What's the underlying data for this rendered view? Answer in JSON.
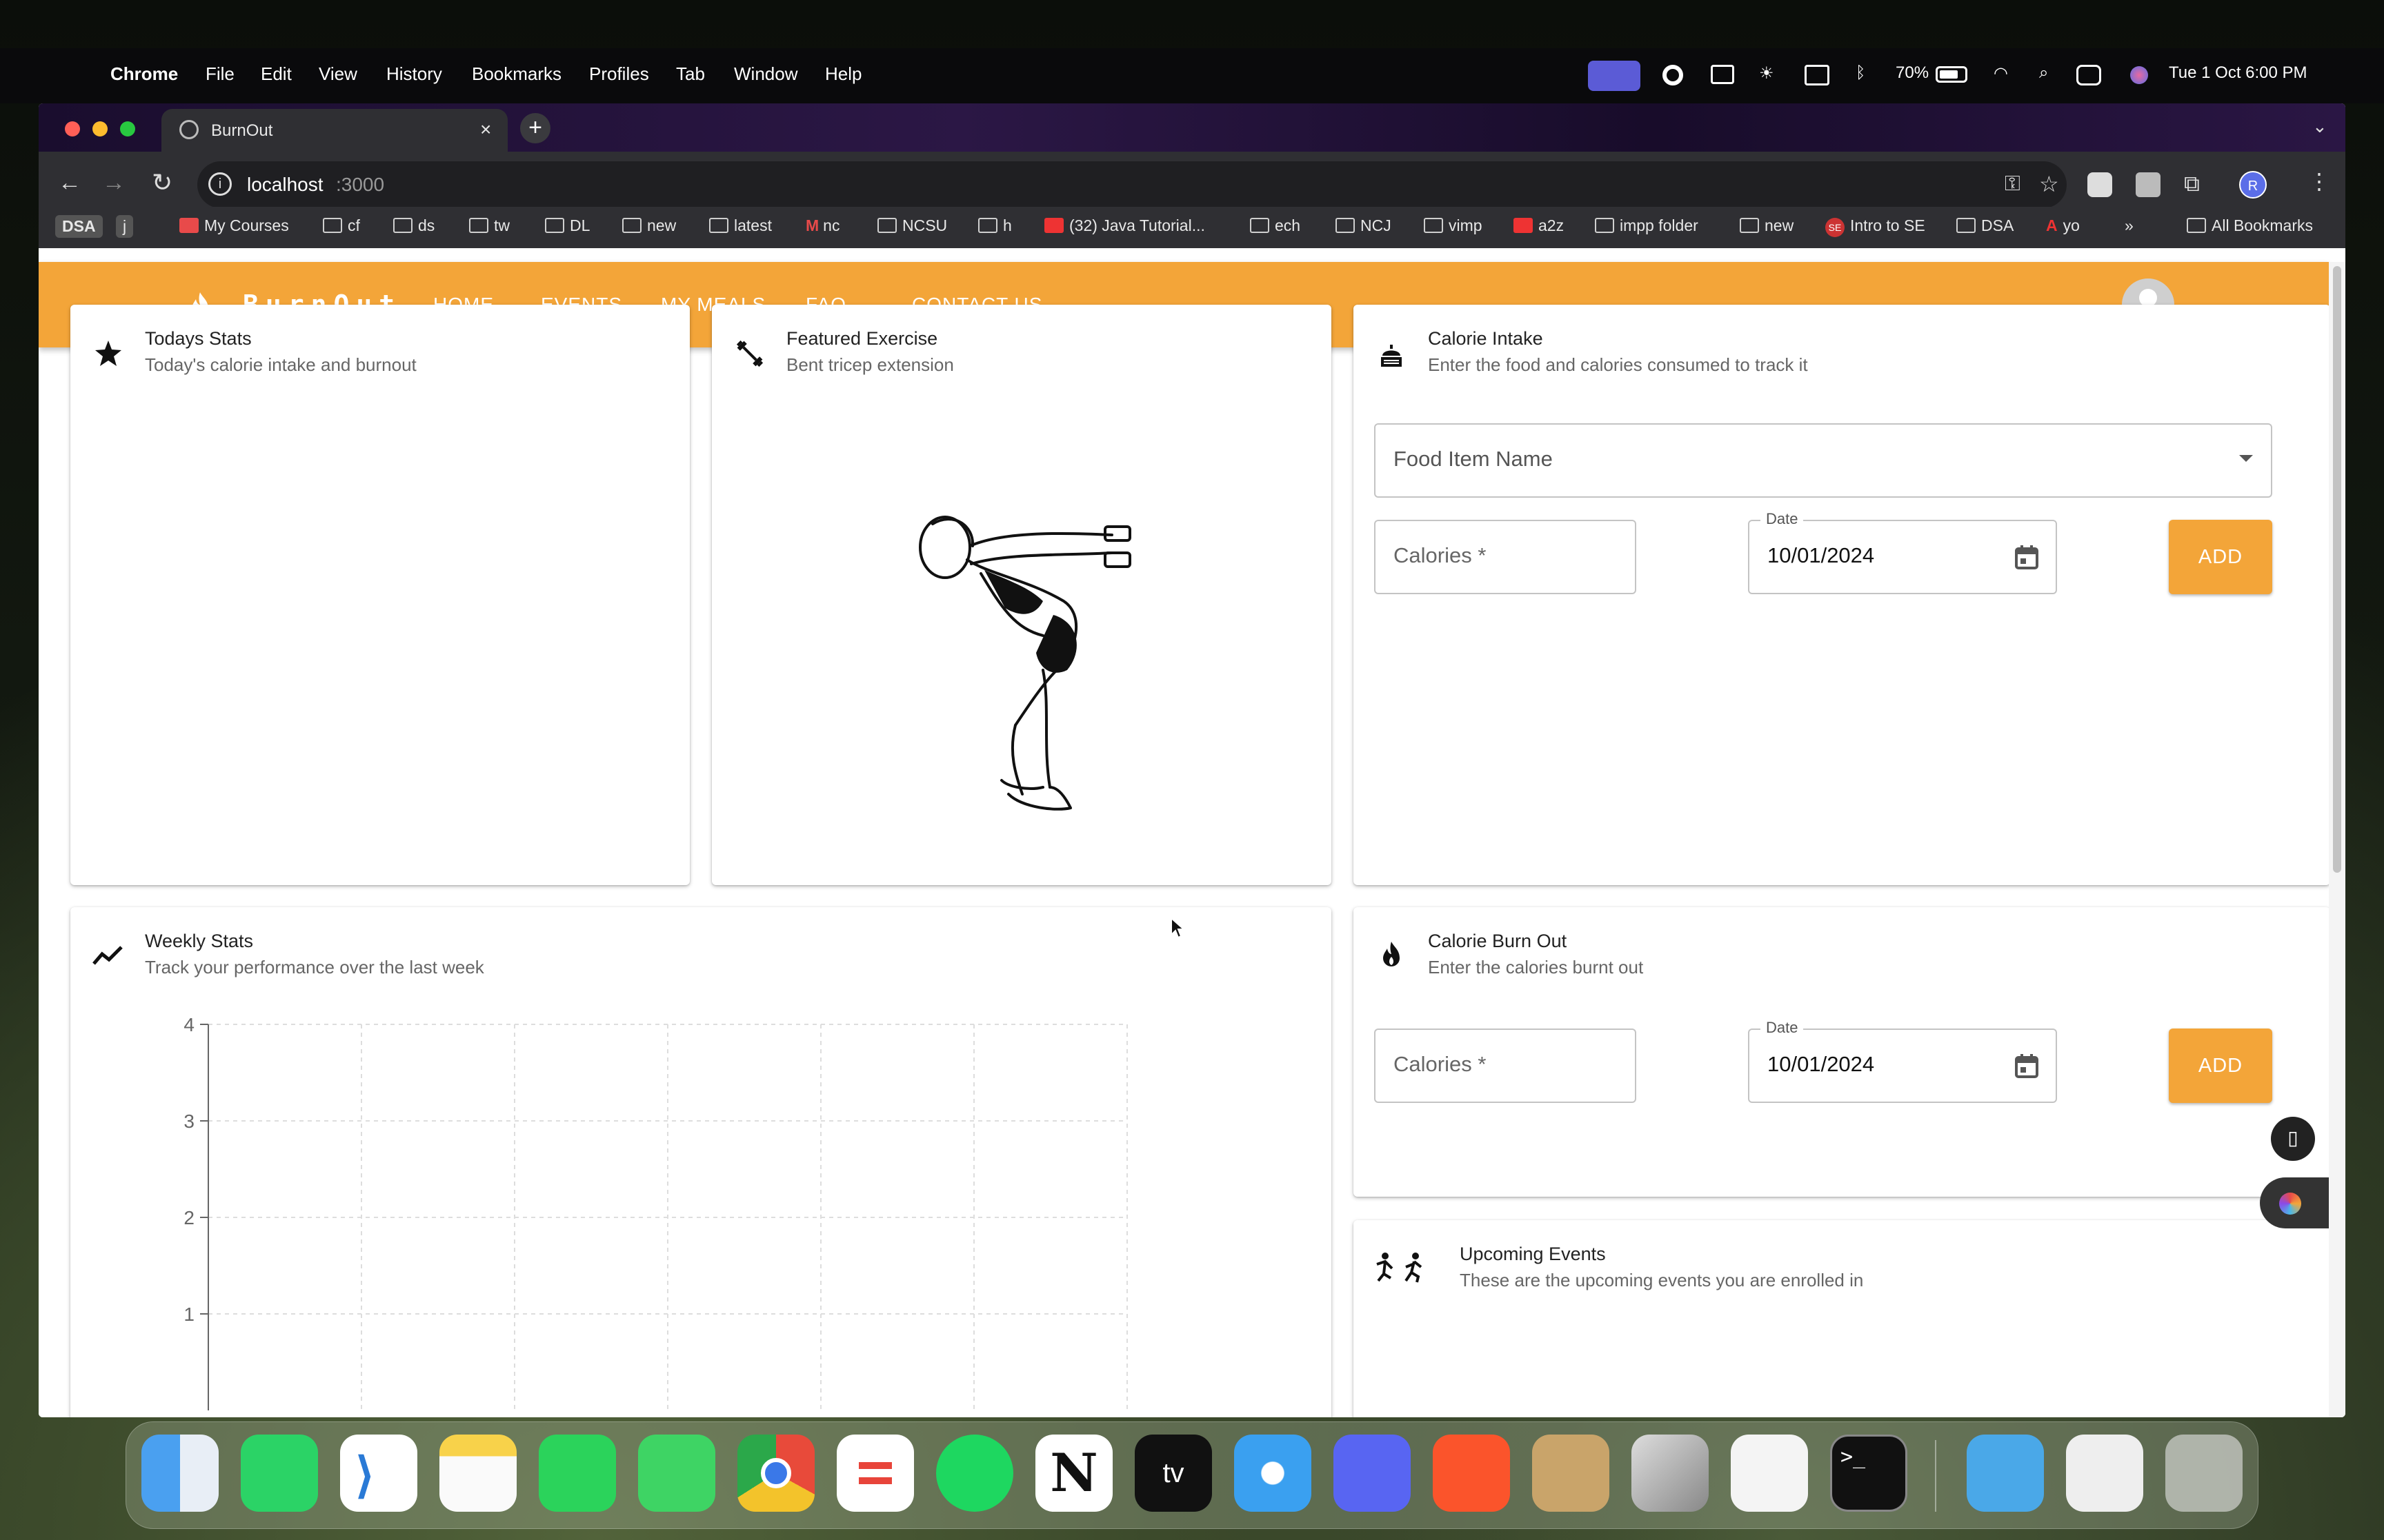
{
  "menubar": {
    "app_name": "Chrome",
    "menus": [
      "File",
      "Edit",
      "View",
      "History",
      "Bookmarks",
      "Profiles",
      "Tab",
      "Window",
      "Help"
    ],
    "battery": "70%",
    "datetime": "Tue 1 Oct  6:00 PM"
  },
  "browser": {
    "tab_title": "BurnOut",
    "url_host": "localhost",
    "url_port": ":3000",
    "bookmarks": [
      "DSA",
      "j",
      "My Courses",
      "cf",
      "ds",
      "tw",
      "DL",
      "new",
      "latest",
      "nc",
      "NCSU",
      "h",
      "(32) Java Tutorial...",
      "ech",
      "NCJ",
      "vimp",
      "a2z",
      "impp folder",
      "new",
      "Intro to SE",
      "DSA",
      "yo"
    ],
    "all_bookmarks": "All Bookmarks",
    "profile_initial": "R"
  },
  "navbar": {
    "logo": "BurnOut",
    "links": [
      "HOME",
      "EVENTS",
      "MY MEALS",
      "FAQ",
      "CONTACT US"
    ]
  },
  "cards": {
    "todays_stats": {
      "title": "Todays Stats",
      "subtitle": "Today's calorie intake and burnout"
    },
    "featured_exercise": {
      "title": "Featured Exercise",
      "subtitle": "Bent tricep extension"
    },
    "calorie_intake": {
      "title": "Calorie Intake",
      "subtitle": "Enter the food and calories consumed to track it",
      "food_placeholder": "Food Item Name",
      "calories_placeholder": "Calories *",
      "date_label": "Date",
      "date_value": "10/01/2024",
      "add_label": "ADD"
    },
    "weekly_stats": {
      "title": "Weekly Stats",
      "subtitle": "Track your performance over the last week"
    },
    "calorie_burn": {
      "title": "Calorie Burn Out",
      "subtitle": "Enter the calories burnt out",
      "calories_placeholder": "Calories *",
      "date_label": "Date",
      "date_value": "10/01/2024",
      "add_label": "ADD"
    },
    "upcoming_events": {
      "title": "Upcoming Events",
      "subtitle": "These are the upcoming events you are enrolled in"
    }
  },
  "chart_data": {
    "type": "line",
    "title": "",
    "xlabel": "",
    "ylabel": "",
    "ylim": [
      0,
      4
    ],
    "yticks": [
      "4",
      "3",
      "2",
      "1"
    ],
    "grid": true,
    "series": []
  },
  "colors": {
    "accent": "#f3a539",
    "nav_text": "#ffffff"
  }
}
